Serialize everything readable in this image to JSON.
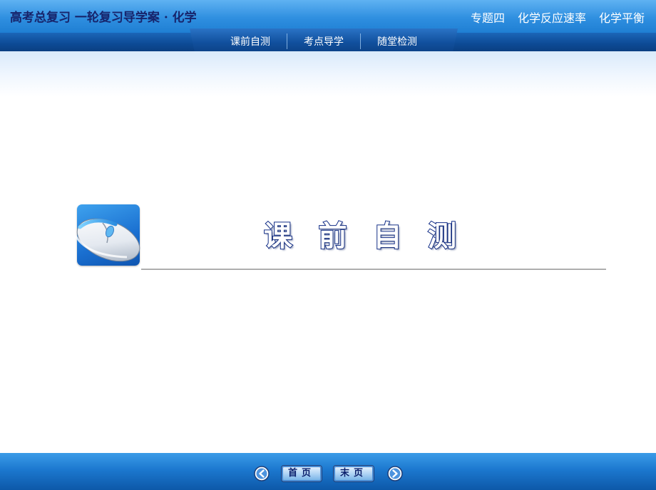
{
  "header": {
    "course_title": "高考总复习 一轮复习导学案 · 化学",
    "topic_parts": [
      "专题四",
      "化学反应速率",
      "化学平衡"
    ]
  },
  "nav": {
    "tabs": [
      {
        "label": "课前自测"
      },
      {
        "label": "考点导学"
      },
      {
        "label": "随堂检测"
      }
    ]
  },
  "section": {
    "title_chars": [
      "课",
      "前",
      "自",
      "测"
    ],
    "icon": "computer-mouse-icon"
  },
  "footer": {
    "prev_icon": "arrow-left-circle-icon",
    "first_label": "首页",
    "last_label": "末页",
    "next_icon": "arrow-right-circle-icon"
  },
  "colors": {
    "header_blue": "#2f8fe0",
    "nav_dark_blue": "#0d4a95",
    "title_outline": "#0f2b86",
    "footer_blue": "#1c78cf"
  }
}
